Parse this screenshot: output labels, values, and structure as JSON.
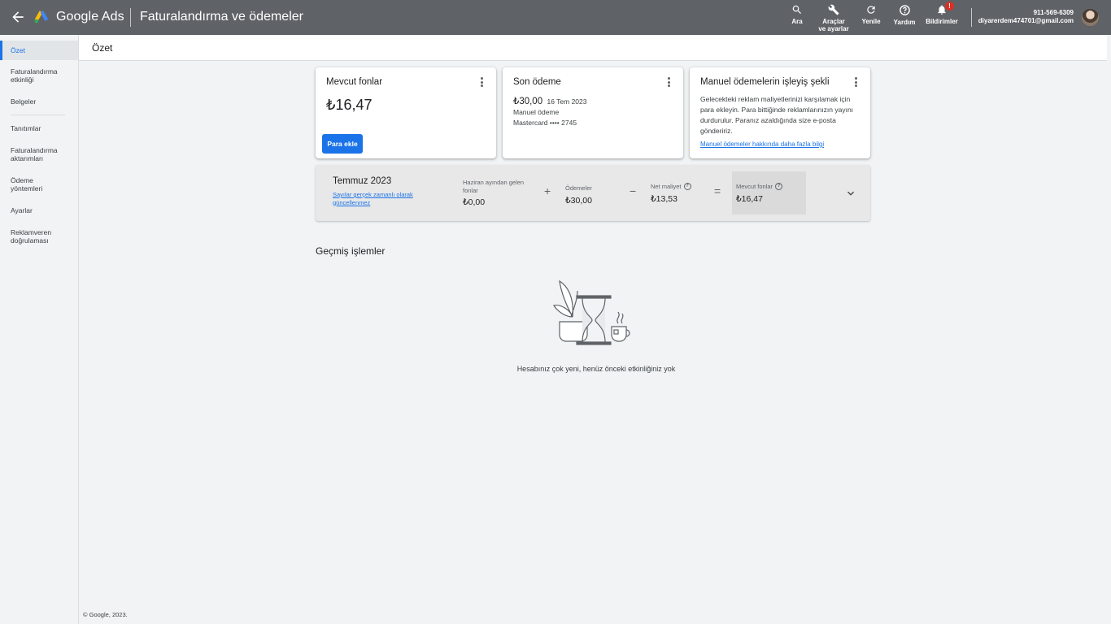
{
  "topbar": {
    "brand": "Google Ads",
    "page_title": "Faturalandırma ve ödemeler",
    "tools": {
      "search": "Ara",
      "tools_line1": "Araçlar",
      "tools_line2": "ve ayarlar",
      "refresh": "Yenile",
      "help": "Yardım",
      "notifications": "Bildirimler",
      "notification_badge": "!"
    },
    "account_id": "911-569-6309",
    "account_email": "diyarerdem474701@gmail.com"
  },
  "sidebar": {
    "items": [
      {
        "label": "Özet",
        "active": true
      },
      {
        "label": "Faturalandırma etkinliği"
      },
      {
        "label": "Belgeler"
      },
      {
        "label": "Tanıtımlar"
      },
      {
        "label": "Faturalandırma aktarımları"
      },
      {
        "label": "Ödeme yöntemleri"
      },
      {
        "label": "Ayarlar"
      },
      {
        "label": "Reklamveren doğrulaması"
      }
    ]
  },
  "subheader": {
    "title": "Özet"
  },
  "cards": {
    "funds": {
      "title": "Mevcut fonlar",
      "amount": "₺16,47",
      "button": "Para ekle"
    },
    "last_payment": {
      "title": "Son ödeme",
      "amount": "₺30,00",
      "date": "16 Tem 2023",
      "type": "Manuel ödeme",
      "card": "Mastercard •••• 2745"
    },
    "manual": {
      "title": "Manuel ödemelerin işleyiş şekli",
      "description": "Gelecekteki reklam maliyetlerinizi karşılamak için para ekleyin. Para bittiğinde reklamlarınızın yayını durdurulur. Paranız azaldığında size e-posta göndeririz.",
      "link": "Manuel ödemeler hakkında daha fazla bilgi"
    }
  },
  "band": {
    "month": "Temmuz 2023",
    "note": "Sayılar gerçek zamanlı olarak güncellenmez",
    "prev_label": "Haziran ayından gelen fonlar",
    "prev_value": "₺0,00",
    "op1": "+",
    "payments_label": "Ödemeler",
    "payments_value": "₺30,00",
    "op2": "−",
    "netcost_label": "Net maliyet",
    "netcost_value": "₺13,53",
    "op3": "=",
    "available_label": "Mevcut fonlar",
    "available_value": "₺16,47"
  },
  "history": {
    "title": "Geçmiş işlemler",
    "empty": "Hesabınız çok yeni, henüz önceki etkinliğiniz yok"
  },
  "footer": "© Google, 2023.",
  "colors": {
    "topbar": "#5f6368",
    "accent": "#1a73e8",
    "badge": "#d93025"
  }
}
